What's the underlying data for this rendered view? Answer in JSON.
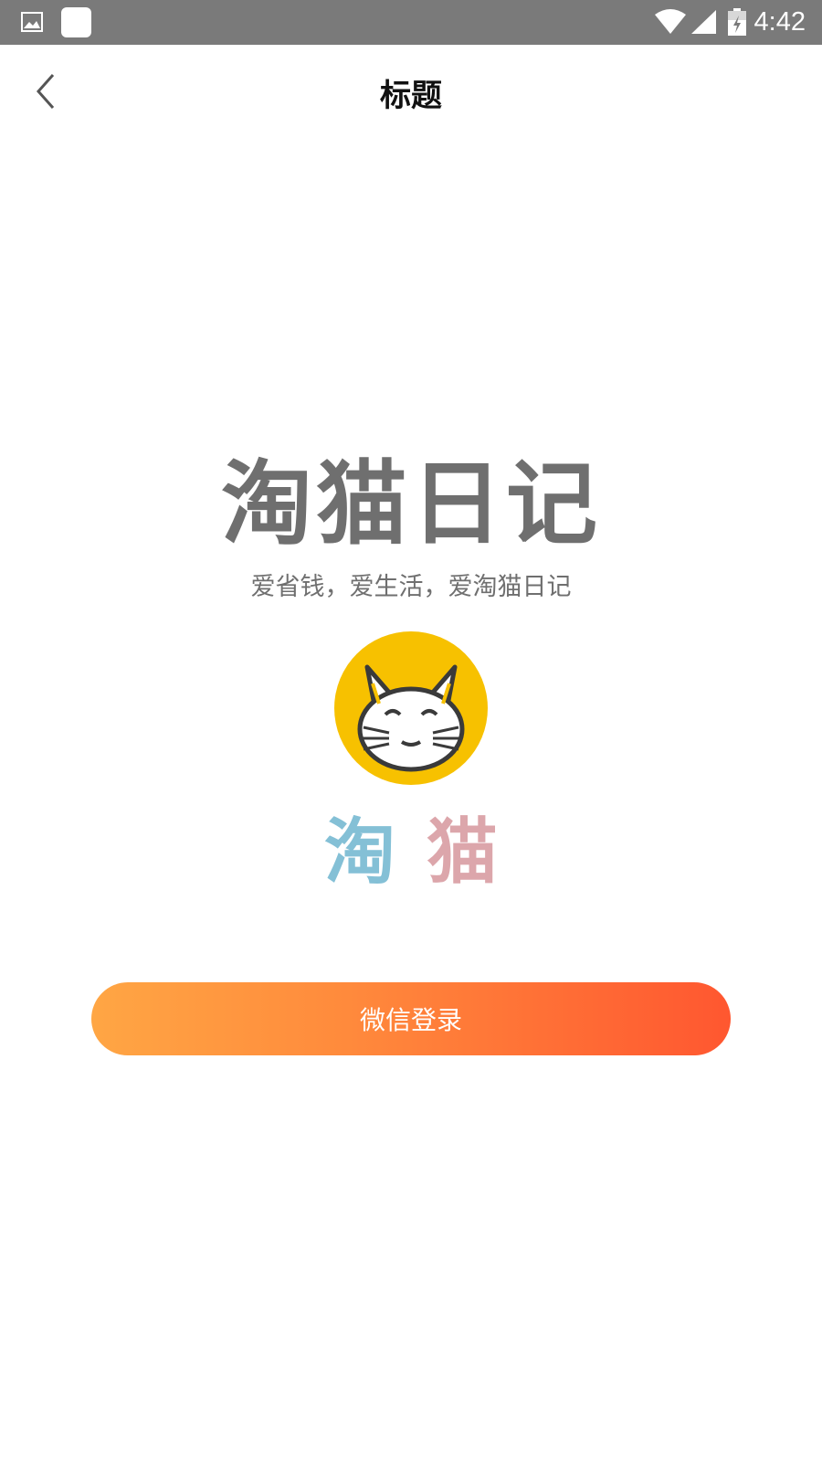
{
  "status_bar": {
    "time": "4:42",
    "icons": [
      "image-icon",
      "app-square-icon",
      "wifi-icon",
      "signal-icon",
      "battery-icon"
    ]
  },
  "nav": {
    "title": "标题",
    "back_icon": "chevron-left-icon"
  },
  "brand": {
    "title": "淘猫日记",
    "slogan": "爱省钱，爱生活，爱淘猫日记"
  },
  "logo": {
    "char_1": "淘",
    "char_2": "猫",
    "circle_color": "#f7c100"
  },
  "login": {
    "wechat_button_label": "微信登录",
    "gradient_start": "#ffa644",
    "gradient_end": "#ff5730"
  }
}
